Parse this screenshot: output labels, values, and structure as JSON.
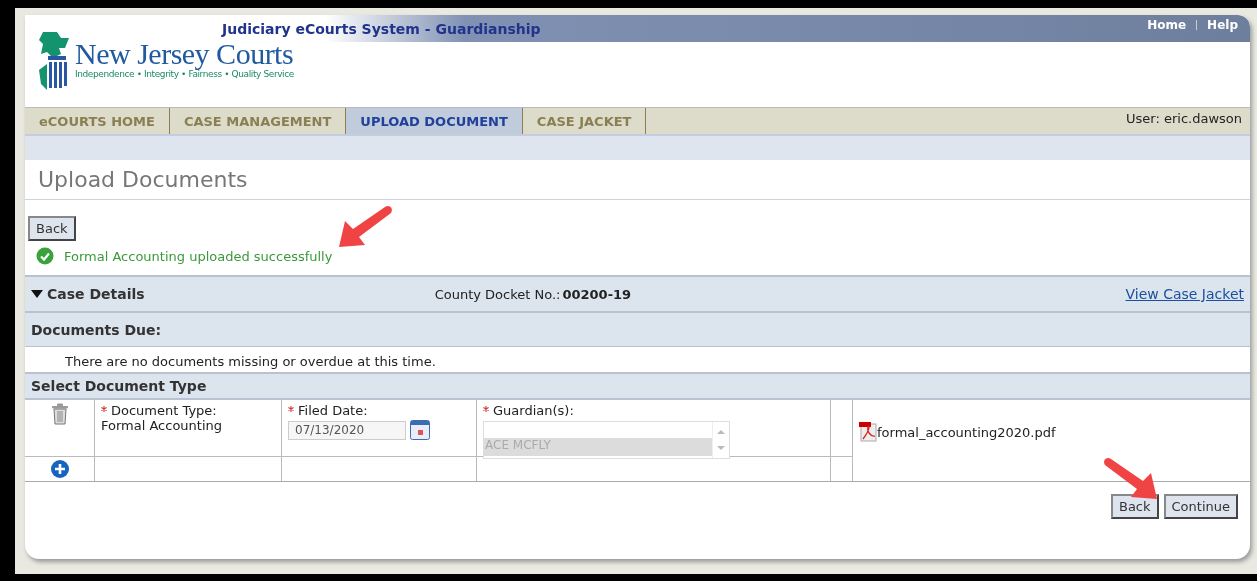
{
  "header": {
    "system_title": "Judiciary eCourts System - Guardianship",
    "top_links": [
      "Home",
      "Help"
    ],
    "logo_name": "New Jersey Courts",
    "logo_tagline": "Independence • Integrity • Fairness • Quality Service"
  },
  "nav": {
    "tabs": [
      {
        "label": "eCOURTS HOME",
        "selected": false
      },
      {
        "label": "CASE MANAGEMENT",
        "selected": false
      },
      {
        "label": "UPLOAD DOCUMENT",
        "selected": true
      },
      {
        "label": "CASE JACKET",
        "selected": false
      }
    ],
    "user": "User: eric.dawson"
  },
  "page_title": "Upload Documents",
  "top_button": "Back",
  "message": {
    "kind": "success",
    "text": "Formal Accounting uploaded successfully"
  },
  "case_details": {
    "label": "Case Details",
    "expanded": true,
    "docket_label": "County Docket No.:",
    "docket_value": "00200-19",
    "link": "View Case Jacket"
  },
  "documents_due": {
    "title": "Documents Due:",
    "message": "There are no documents missing or overdue at this time."
  },
  "select_document": {
    "title": "Select Document Type",
    "doc_type_label": "Document Type:",
    "doc_type_value": "Formal Accounting",
    "filed_date_label": "Filed Date:",
    "filed_date_value": "07/13/2020",
    "guardian_label": "Guardian(s):",
    "guardian_value": "ACE MCFLY",
    "guardian_disabled": true,
    "file_name": "formal_accounting2020.pdf"
  },
  "buttons": [
    "Back",
    "Continue"
  ]
}
